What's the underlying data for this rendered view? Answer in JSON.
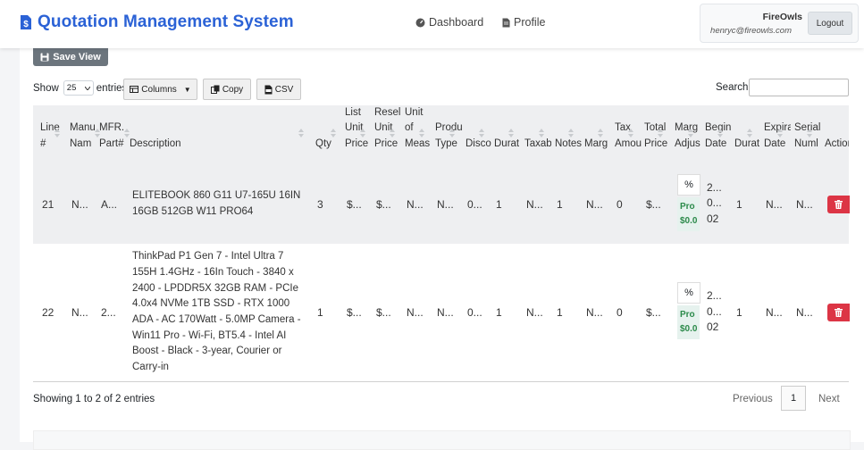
{
  "app": {
    "title": "Quotation Management System"
  },
  "nav": {
    "dashboard": "Dashboard",
    "profile": "Profile"
  },
  "user": {
    "name": "FireOwls",
    "email": "henryc@fireowls.com",
    "logout": "Logout"
  },
  "toolbar": {
    "save_view": "Save View",
    "show_label": "Show",
    "entries_label": "entries",
    "length_value": "25",
    "columns_btn": "Columns",
    "copy_btn": "Copy",
    "csv_btn": "CSV",
    "search_label": "Search:"
  },
  "table": {
    "headers": [
      {
        "lines": [
          "Line",
          "#"
        ]
      },
      {
        "lines": [
          "Manu",
          "Nam"
        ]
      },
      {
        "lines": [
          "MFR.",
          "Part#"
        ]
      },
      {
        "lines": [
          "Description"
        ]
      },
      {
        "lines": [
          "Qty"
        ]
      },
      {
        "lines": [
          "List",
          "Unit",
          "Price"
        ]
      },
      {
        "lines": [
          "Resel",
          "Unit",
          "Price"
        ]
      },
      {
        "lines": [
          "Unit",
          "of",
          "Meas"
        ]
      },
      {
        "lines": [
          "Produ",
          "Type"
        ]
      },
      {
        "lines": [
          "Disco"
        ]
      },
      {
        "lines": [
          "Durat"
        ]
      },
      {
        "lines": [
          "Taxab"
        ]
      },
      {
        "lines": [
          "Notes"
        ]
      },
      {
        "lines": [
          "Marg"
        ]
      },
      {
        "lines": [
          "Tax",
          "Amou"
        ]
      },
      {
        "lines": [
          "Total",
          "Price"
        ]
      },
      {
        "lines": [
          "Marg",
          "Adjus"
        ]
      },
      {
        "lines": [
          "Begin",
          "Date"
        ]
      },
      {
        "lines": [
          "Durat"
        ]
      },
      {
        "lines": [
          "Expira",
          "Date"
        ]
      },
      {
        "lines": [
          "Serial",
          "Numl"
        ]
      },
      {
        "lines": [
          "Action"
        ]
      }
    ],
    "rows": [
      {
        "line": "21",
        "manu": "N...",
        "mfr": "A...",
        "description": "ELITEBOOK 860 G11 U7-165U 16IN 16GB 512GB W11 PRO64",
        "qty": "3",
        "list": "$...",
        "resel": "$...",
        "uom": "N...",
        "prod": "N...",
        "disc": "0...",
        "dur": "1",
        "taxab": "N...",
        "notes": "1",
        "marg": "N...",
        "tax": "0",
        "total": "$...",
        "adj_pct": "%",
        "adj_pro": "Pro",
        "adj_amt": "$0.0",
        "begin1": "2...",
        "begin2": "0...",
        "begin3": "02",
        "dur2": "1",
        "exp": "N...",
        "serial": "N..."
      },
      {
        "line": "22",
        "manu": "N...",
        "mfr": "2...",
        "description": "ThinkPad P1 Gen 7 - Intel Ultra 7 155H 1.4GHz - 16In Touch - 3840 x 2400 - LPDDR5X 32GB RAM - PCIe 4.0x4 NVMe 1TB SSD - RTX 1000 ADA - AC 170Watt - 5.0MP Camera - Win11 Pro - Wi-Fi, BT5.4 - Intel AI Boost - Black - 3-year, Courier or Carry-in",
        "qty": "1",
        "list": "$...",
        "resel": "$...",
        "uom": "N...",
        "prod": "N...",
        "disc": "0...",
        "dur": "1",
        "taxab": "N...",
        "notes": "1",
        "marg": "N...",
        "tax": "0",
        "total": "$...",
        "adj_pct": "%",
        "adj_pro": "Pro",
        "adj_amt": "$0.0",
        "begin1": "2...",
        "begin2": "0...",
        "begin3": "02",
        "dur2": "1",
        "exp": "N...",
        "serial": "N..."
      }
    ]
  },
  "footer": {
    "info": "Showing 1 to 2 of 2 entries",
    "previous": "Previous",
    "page": "1",
    "next": "Next"
  },
  "colors": {
    "brand": "#2b62d6",
    "danger": "#dc3545",
    "save_view_bg": "#6c757d",
    "success_text": "#2b8a4a"
  },
  "icons": {
    "brand": "dollar-file-icon",
    "dashboard": "gauge-icon",
    "profile": "file-icon",
    "save": "floppy-icon",
    "columns": "table-icon",
    "copy": "copy-icon",
    "csv": "csv-file-icon",
    "delete": "trash-icon"
  }
}
